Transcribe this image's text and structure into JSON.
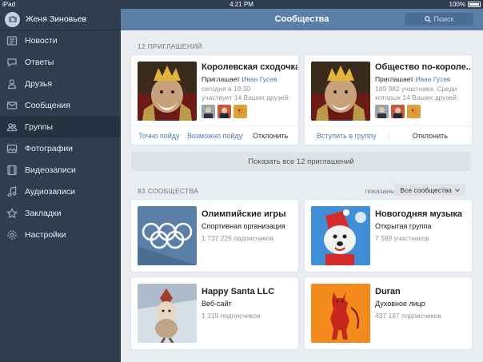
{
  "status_bar": {
    "carrier": "iPad",
    "time": "4:21 PM",
    "battery": "100%"
  },
  "sidebar": {
    "profile_name": "Женя Зиновьев",
    "items": [
      {
        "label": "Новости",
        "icon": "news-icon"
      },
      {
        "label": "Ответы",
        "icon": "chat-bubble-icon"
      },
      {
        "label": "Друзья",
        "icon": "person-icon"
      },
      {
        "label": "Сообщения",
        "icon": "envelope-icon"
      },
      {
        "label": "Группы",
        "icon": "group-icon",
        "active": true
      },
      {
        "label": "Фотографии",
        "icon": "photo-icon"
      },
      {
        "label": "Видеозаписи",
        "icon": "film-icon"
      },
      {
        "label": "Аудиозаписи",
        "icon": "music-note-icon"
      },
      {
        "label": "Закладки",
        "icon": "star-icon"
      },
      {
        "label": "Настройки",
        "icon": "gear-icon"
      }
    ]
  },
  "header": {
    "title": "Сообщества",
    "search_placeholder": "Поиск"
  },
  "invitations": {
    "section_label": "12 ПРИГЛАШЕНИЙ",
    "cards": [
      {
        "title": "Королевская сходочка",
        "invited_prefix": "Приглашает",
        "inviter": "Иван Гусев",
        "meta1": "сегодня в 19:30",
        "meta2": "участвует 14 Ваших друзей:",
        "actions": [
          "Точно пойду",
          "Возможно пойду",
          "Отклонить"
        ]
      },
      {
        "title": "Общество по-короле...",
        "invited_prefix": "Приглашает",
        "inviter": "Иван Гусев",
        "meta1": "189 982 участника. Среди",
        "meta2": "которых 14 Ваших друзей:",
        "actions": [
          "Вступить в группу",
          "Отклонить"
        ]
      }
    ],
    "show_all": "Показать все 12 приглашений"
  },
  "communities": {
    "section_label": "83 СООБЩЕСТВА",
    "filter_label": "показаны",
    "filter_value": "Все сообщества",
    "items": [
      {
        "name": "Олимпийские игры",
        "type": "Спортивная организация",
        "count": "1 737 226 подписчиков"
      },
      {
        "name": "Новогодняя музыка",
        "type": "Открытая группа",
        "count": "7 589 участников"
      },
      {
        "name": "Happy Santa LLC",
        "type": "Веб-сайт",
        "count": "1 319 подписчиков"
      },
      {
        "name": "Duran",
        "type": "Духовное лицо",
        "count": "437 187 подписчиков"
      }
    ]
  }
}
